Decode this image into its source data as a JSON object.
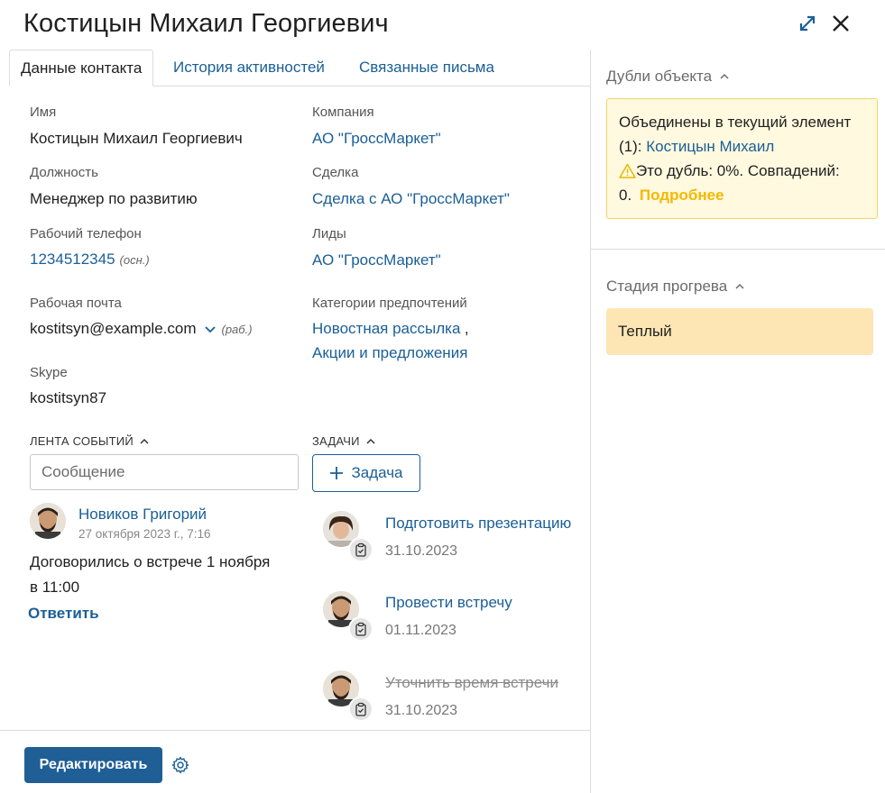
{
  "title": "Костицын Михаил Георгиевич",
  "tabs": [
    {
      "label": "Данные контакта"
    },
    {
      "label": "История активностей"
    },
    {
      "label": "Связанные письма"
    }
  ],
  "fields": {
    "name": {
      "label": "Имя",
      "value": "Костицын Михаил Георгиевич"
    },
    "position": {
      "label": "Должность",
      "value": "Менеджер по развитию"
    },
    "work_phone": {
      "label": "Рабочий телефон",
      "value": "1234512345",
      "tag": "(осн.)"
    },
    "work_email": {
      "label": "Рабочая почта",
      "value": "kostitsyn@example.com",
      "tag": "(раб.)"
    },
    "skype": {
      "label": "Skype",
      "value": "kostitsyn87"
    },
    "company": {
      "label": "Компания",
      "value": "АО \"ГроссМаркет\""
    },
    "deal": {
      "label": "Сделка",
      "value": "Сделка с АО \"ГроссМаркет\""
    },
    "leads": {
      "label": "Лиды",
      "value": "АО \"ГроссМаркет\""
    },
    "preferences": {
      "label": "Категории предпочтений",
      "items": [
        "Новостная рассылка",
        "Акции и предложения"
      ],
      "separator": ","
    }
  },
  "feed": {
    "header": "ЛЕНТА СОБЫТИЙ",
    "input_placeholder": "Сообщение",
    "post": {
      "author": "Новиков Григорий",
      "date": "27 октября 2023 г., 7:16",
      "text_line1": "Договорились о встрече 1 ноября",
      "text_line2": "в 11:00",
      "reply": "Ответить"
    }
  },
  "tasks": {
    "header": "ЗАДАЧИ",
    "add_button": "Задача",
    "items": [
      {
        "title": "Подготовить презентацию",
        "date": "31.10.2023",
        "done": false
      },
      {
        "title": "Провести встречу",
        "date": "01.11.2023",
        "done": false
      },
      {
        "title": "Уточнить время встречи",
        "date": "31.10.2023",
        "done": true
      }
    ]
  },
  "right_panel": {
    "duplicates": {
      "header": "Дубли объекта",
      "line1": "Объединены в текущий элемент",
      "count_prefix": "(1): ",
      "merged_link": "Костицын Михаил",
      "warning_text": "Это дубль: 0%. Совпадений:",
      "matches": "0.",
      "more_link": "Подробнее"
    },
    "stage": {
      "header": "Стадия прогрева",
      "value": "Теплый"
    }
  },
  "footer": {
    "edit_button": "Редактировать"
  },
  "colors": {
    "link": "#1a5f96",
    "primary_button": "#1f5f96",
    "warning_bg": "#fff9df",
    "warning_border": "#f2d46a",
    "more_link": "#f5b800",
    "stage_bg": "#fde6b3"
  },
  "icons": {
    "expand": "expand-arrows-icon",
    "close": "close-icon",
    "chevron_up": "chevron-up-icon",
    "chevron_down": "chevron-down-icon",
    "plus": "plus-icon",
    "clipboard": "clipboard-check-icon",
    "warning": "warning-triangle-icon",
    "gear": "gear-icon"
  }
}
